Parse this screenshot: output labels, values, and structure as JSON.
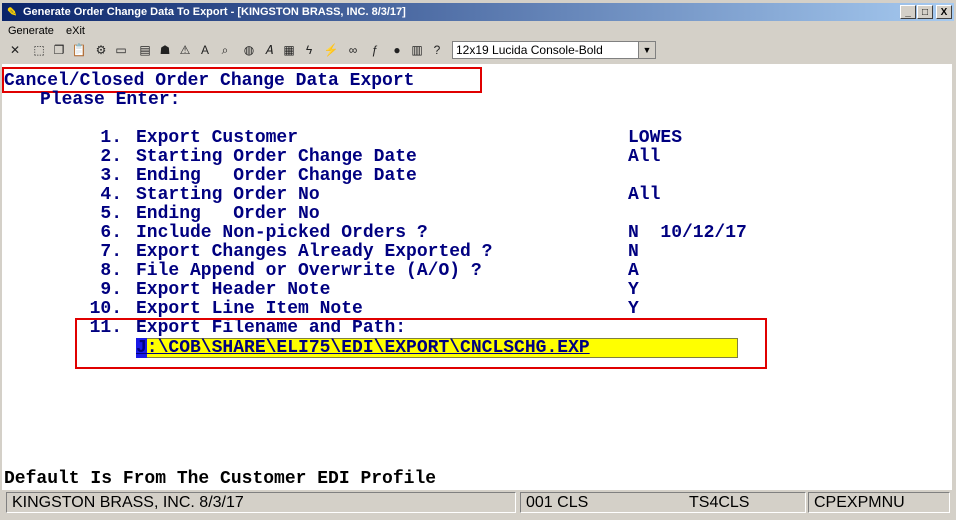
{
  "window": {
    "title": "Generate Order Change Data To Export - [KINGSTON BRASS, INC. 8/3/17]",
    "controls": [
      "_",
      "□",
      "X"
    ]
  },
  "menu": {
    "items": [
      "Generate",
      "eXit"
    ]
  },
  "toolbar": {
    "font_select": "12x19 Lucida Console-Bold"
  },
  "screen": {
    "heading": "Cancel/Closed Order Change Data Export",
    "prompt": "Please Enter:",
    "items": [
      {
        "num": "1.",
        "label": "Export Customer",
        "value": "LOWES"
      },
      {
        "num": "2.",
        "label": "Starting Order Change Date",
        "value": "All"
      },
      {
        "num": "3.",
        "label": "Ending   Order Change Date",
        "value": ""
      },
      {
        "num": "4.",
        "label": "Starting Order No",
        "value": "All"
      },
      {
        "num": "5.",
        "label": "Ending   Order No",
        "value": ""
      },
      {
        "num": "6.",
        "label": "Include Non-picked Orders ?",
        "value": "N  10/12/17"
      },
      {
        "num": "7.",
        "label": "Export Changes Already Exported ?",
        "value": "N"
      },
      {
        "num": "8.",
        "label": "File Append or Overwrite (A/O) ?",
        "value": "A"
      },
      {
        "num": "9.",
        "label": "Export Header Note",
        "value": "Y"
      },
      {
        "num": "10.",
        "label": "Export Line Item Note",
        "value": "Y"
      },
      {
        "num": "11.",
        "label": "Export Filename and Path:",
        "value": ""
      }
    ],
    "filename_value": "J:\\COB\\SHARE\\ELI75\\EDI\\EXPORT\\CNCLSCHG.EXP",
    "footer_message": "Default Is From The Customer EDI Profile"
  },
  "status": {
    "company": "KINGSTON BRASS, INC. 8/3/17",
    "code": "001 CLS",
    "session": "TS4CLS",
    "program": "CPEXPMNU"
  }
}
